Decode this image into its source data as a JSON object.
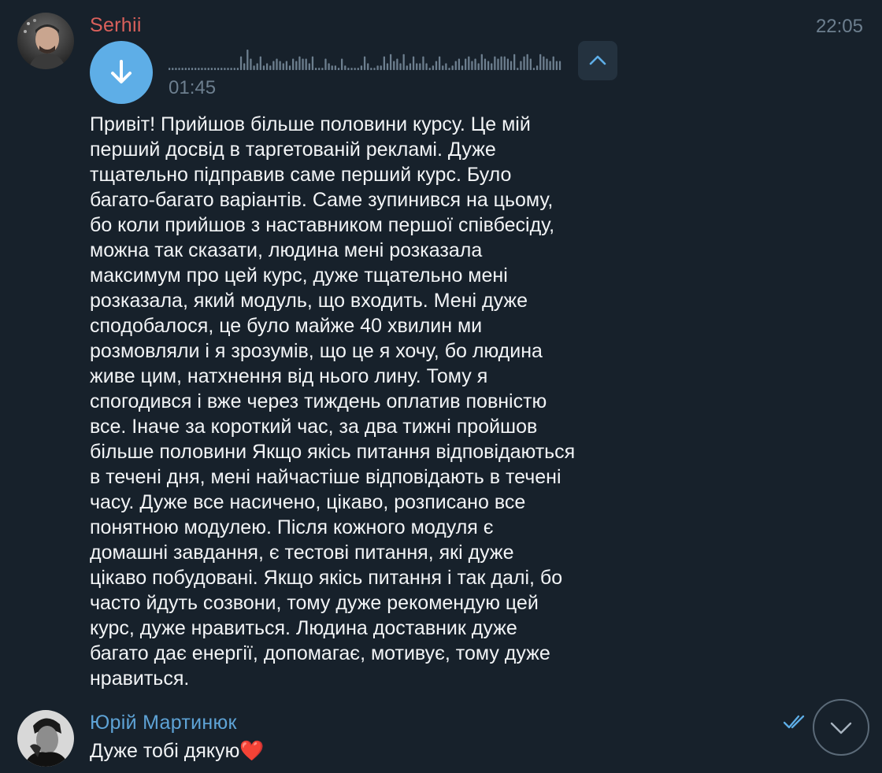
{
  "messages": [
    {
      "sender": "Serhii",
      "sender_color": "#d9605b",
      "time": "22:05",
      "voice": {
        "duration": "01:45",
        "waveform": [
          1,
          1,
          1,
          1,
          1,
          1,
          1,
          1,
          1,
          1,
          1,
          1,
          1,
          1,
          1,
          1,
          1,
          1,
          1,
          1,
          1,
          1,
          6,
          3,
          9,
          5,
          2,
          3,
          6,
          2,
          3,
          2,
          4,
          5,
          4,
          3,
          4,
          2,
          5,
          4,
          6,
          5,
          5,
          3,
          6,
          1,
          1,
          1,
          5,
          3,
          2,
          2,
          1,
          5,
          2,
          1,
          1,
          1,
          1,
          2,
          6,
          3,
          1,
          1,
          2,
          2,
          6,
          3,
          7,
          4,
          5,
          3,
          7,
          2,
          3,
          6,
          3,
          3,
          6,
          3,
          1,
          2,
          4,
          6,
          2,
          3,
          1,
          2,
          4,
          5,
          2,
          5,
          6,
          4,
          5,
          3,
          7,
          5,
          4,
          3,
          6,
          5,
          6,
          6,
          5,
          4,
          7,
          1,
          4,
          6,
          7,
          5,
          1,
          2,
          7,
          6,
          5,
          4,
          6,
          4,
          4
        ]
      },
      "text": "Привіт! Прийшов більше половини курсу. Це мій\nперший досвід в таргетованій рекламі. Дуже\nтщательно підправив саме перший курс. Було\nбагато-багато варіантів. Саме зупинився на цьому,\nбо коли прийшов з наставником першої співбесіду,\nможна так сказати, людина мені розказала\nмаксимум про цей курс, дуже тщательно мені\nрозказала, який модуль, що входить. Мені дуже\nсподобалося, це було майже 40 хвилин ми\nрозмовляли і я зрозумів, що це я хочу, бо людина\nживе цим, натхнення від нього лину. Тому я\nспогодився і вже через тиждень оплатив повністю\nвсе. Іначе за короткий час, за два тижні пройшов\nбільше половини Якщо якісь питання відповідаються\nв течені дня, мені найчастіше відповідають в течені\nчасу. Дуже все насичено, цікаво, розписано все\nпонятною модулею. Після кожного модуля є\nдомашні завдання, є тестові питання, які дуже\nцікаво побудовані. Якщо якісь питання і так далі, бо\nчасто йдуть созвони, тому дуже рекомендую цей\nкурс, дуже нравиться. Людина доставник дуже\nбагато дає енергії, допомагає, мотивує, тому дуже\nнравиться."
    },
    {
      "sender": "Юрій Мартинюк",
      "sender_color": "#5ea3d6",
      "text": "Дуже тобі дякую",
      "emoji": "❤️"
    }
  ],
  "colors": {
    "background": "#17212b",
    "accent": "#5eaee7",
    "muted": "#6d7f8f"
  },
  "icons": {
    "voice_button": "download-arrow-icon",
    "collapse_button": "chevron-up-icon",
    "read_status": "double-check-icon",
    "scroll_down": "chevron-down-icon"
  }
}
